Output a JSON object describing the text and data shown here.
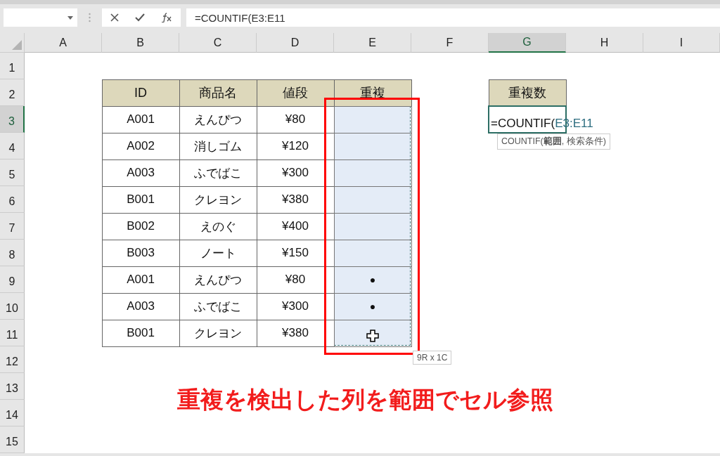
{
  "formula_bar": {
    "value": "=COUNTIF(E3:E11"
  },
  "columns": [
    {
      "label": "A",
      "selected": false
    },
    {
      "label": "B",
      "selected": false
    },
    {
      "label": "C",
      "selected": false
    },
    {
      "label": "D",
      "selected": false
    },
    {
      "label": "E",
      "selected": false
    },
    {
      "label": "F",
      "selected": false
    },
    {
      "label": "G",
      "selected": true
    },
    {
      "label": "H",
      "selected": false
    },
    {
      "label": "I",
      "selected": false
    }
  ],
  "rows": [
    {
      "label": "1",
      "selected": false
    },
    {
      "label": "2",
      "selected": false
    },
    {
      "label": "3",
      "selected": true
    },
    {
      "label": "4",
      "selected": false
    },
    {
      "label": "5",
      "selected": false
    },
    {
      "label": "6",
      "selected": false
    },
    {
      "label": "7",
      "selected": false
    },
    {
      "label": "8",
      "selected": false
    },
    {
      "label": "9",
      "selected": false
    },
    {
      "label": "10",
      "selected": false
    },
    {
      "label": "11",
      "selected": false
    },
    {
      "label": "12",
      "selected": false
    },
    {
      "label": "13",
      "selected": false
    },
    {
      "label": "14",
      "selected": false
    },
    {
      "label": "15",
      "selected": false
    }
  ],
  "table": {
    "headers": [
      "ID",
      "商品名",
      "値段",
      "重複"
    ],
    "rows": [
      {
        "id": "A001",
        "name": "えんぴつ",
        "price": "¥80"
      },
      {
        "id": "A002",
        "name": "消しゴム",
        "price": "¥120"
      },
      {
        "id": "A003",
        "name": "ふでばこ",
        "price": "¥300"
      },
      {
        "id": "B001",
        "name": "クレヨン",
        "price": "¥380"
      },
      {
        "id": "B002",
        "name": "えのぐ",
        "price": "¥400"
      },
      {
        "id": "B003",
        "name": "ノート",
        "price": "¥150"
      },
      {
        "id": "A001",
        "name": "えんぴつ",
        "price": "¥80",
        "dup": "●"
      },
      {
        "id": "A003",
        "name": "ふでばこ",
        "price": "¥300",
        "dup": "●"
      },
      {
        "id": "B001",
        "name": "クレヨン",
        "price": "¥380"
      }
    ]
  },
  "summary": {
    "header": "重複数",
    "formula_prefix": "=COUNTIF(",
    "formula_ref": "E3:E11"
  },
  "function_tooltip": "COUNTIF(**範囲**, 検索条件)",
  "selection_size": "9R x 1C",
  "caption": "重複を検出した列を範囲でセル参照"
}
